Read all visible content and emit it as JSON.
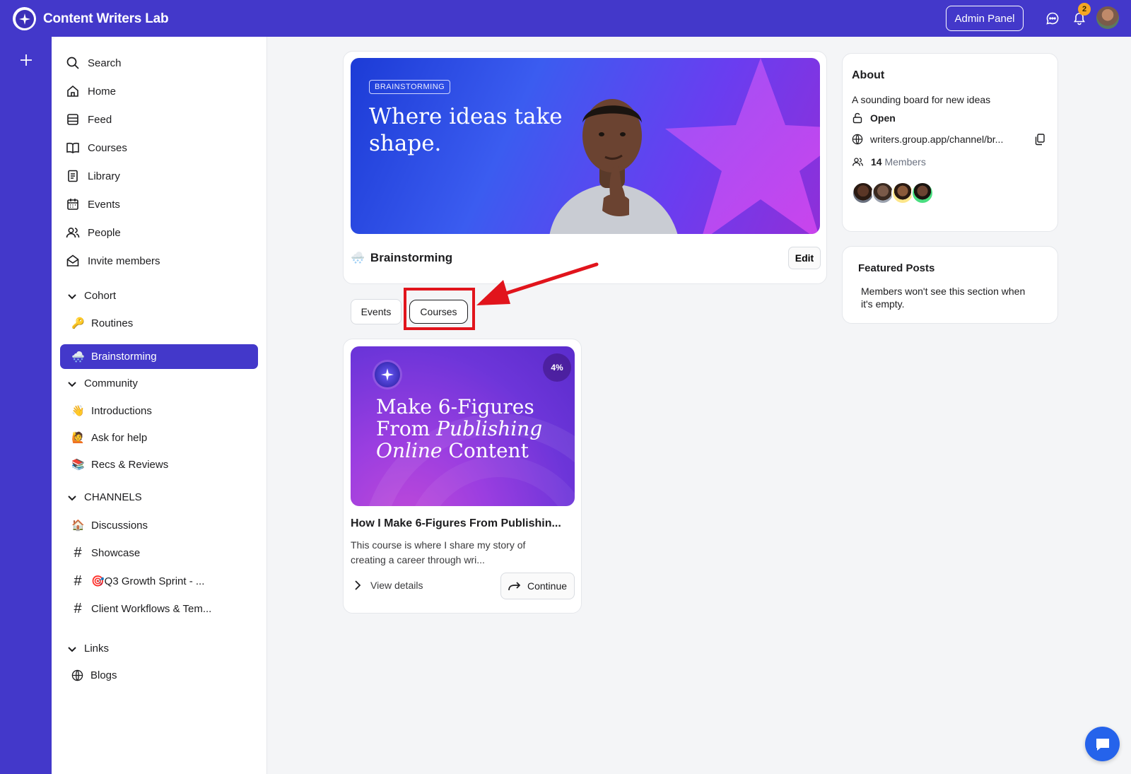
{
  "app": {
    "title": "Content Writers Lab",
    "admin_label": "Admin Panel",
    "notification_count": "2"
  },
  "sidebar": {
    "main": [
      {
        "label": "Search",
        "icon": "search-icon"
      },
      {
        "label": "Home",
        "icon": "home-icon"
      },
      {
        "label": "Feed",
        "icon": "feed-icon"
      },
      {
        "label": "Courses",
        "icon": "book-icon"
      },
      {
        "label": "Library",
        "icon": "library-icon"
      },
      {
        "label": "Events",
        "icon": "calendar-icon"
      },
      {
        "label": "People",
        "icon": "people-icon"
      },
      {
        "label": "Invite members",
        "icon": "mail-icon"
      }
    ],
    "cohort": {
      "title": "Cohort",
      "items": [
        {
          "emoji": "🔑",
          "label": "Routines"
        },
        {
          "emoji": "🌨️",
          "label": "Brainstorming"
        }
      ]
    },
    "community": {
      "title": "Community",
      "items": [
        {
          "emoji": "👋",
          "label": "Introductions"
        },
        {
          "emoji": "🙋",
          "label": "Ask for help"
        },
        {
          "emoji": "📚",
          "label": "Recs & Reviews"
        }
      ]
    },
    "channels": {
      "title": "CHANNELS",
      "items": [
        {
          "emoji": "🏠",
          "label": "Discussions"
        },
        {
          "label": "Showcase"
        },
        {
          "label": "🎯Q3 Growth Sprint - ..."
        },
        {
          "label": "Client Workflows & Tem..."
        }
      ]
    },
    "links": {
      "title": "Links",
      "items": [
        {
          "label": "Blogs"
        }
      ]
    }
  },
  "channel": {
    "hero_tag": "BRAINSTORMING",
    "hero_title": "Where ideas take shape.",
    "emoji": "🌨️",
    "name": "Brainstorming",
    "edit_label": "Edit"
  },
  "tabs": [
    {
      "label": "Events"
    },
    {
      "label": "Courses"
    }
  ],
  "course": {
    "image_title_line1": "Make 6-Figures",
    "image_title_line2a": "From ",
    "image_title_line2b": "Publishing",
    "image_title_line3a": "Online",
    "image_title_line3b": " Content",
    "progress": "4%",
    "title": "How I Make 6-Figures From Publishin...",
    "description": "This course is where I share my story of creating a career through wri...",
    "details_label": "View details",
    "continue_label": "Continue"
  },
  "about": {
    "title": "About",
    "description": "A sounding board for new ideas",
    "privacy": "Open",
    "url": "writers.group.app/channel/br...",
    "member_count": "14",
    "member_label": "Members"
  },
  "featured": {
    "title": "Featured Posts",
    "empty_text": "Members won't see this section when it's empty."
  },
  "colors": {
    "brand": "#4338ca",
    "annotation": "#e1141c",
    "fab": "#2563eb"
  }
}
